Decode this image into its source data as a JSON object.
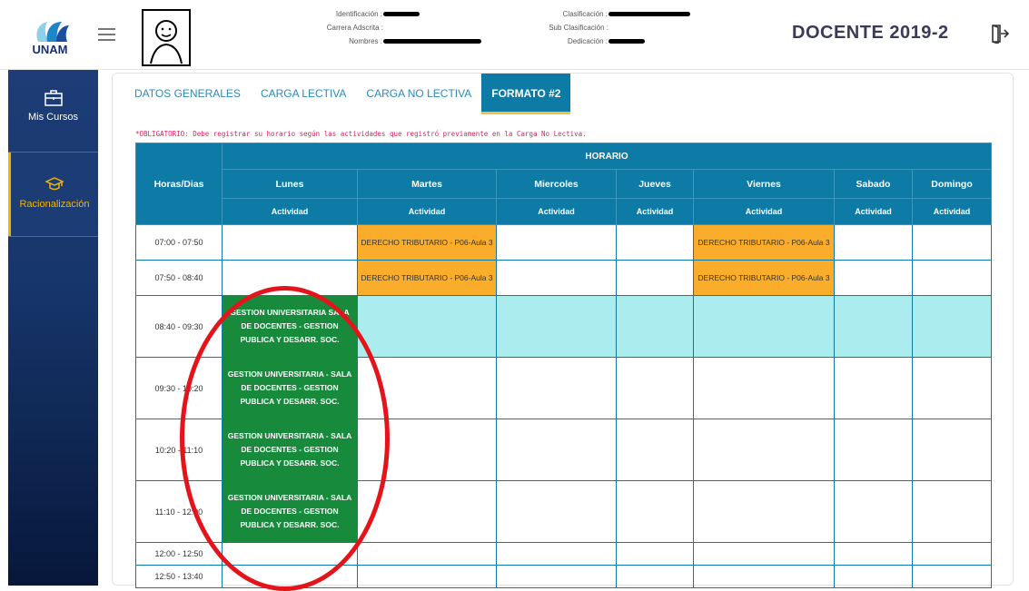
{
  "header": {
    "logo_text": "UNAM",
    "info_left": [
      {
        "label": "Identificación :",
        "redact": 40
      },
      {
        "label": "Carrera Adscrita :",
        "redact": 0
      },
      {
        "label": "Nombres :",
        "redact": 108
      }
    ],
    "info_right": [
      {
        "label": "Clasificación :",
        "redact": 90
      },
      {
        "label": "Sub Clasificación :",
        "redact": 0
      },
      {
        "label": "Dedicación :",
        "redact": 40
      }
    ],
    "page_title": "DOCENTE 2019-2"
  },
  "sidebar": {
    "items": [
      {
        "label": "Mis Cursos",
        "icon": "briefcase-icon"
      },
      {
        "label": "Racionalización",
        "icon": "graduation-cap-icon"
      }
    ]
  },
  "tabs": [
    "DATOS GENERALES",
    "CARGA LECTIVA",
    "CARGA NO LECTIVA",
    "FORMATO #2"
  ],
  "active_tab": "FORMATO #2",
  "notice": "*OBLIGATORIO: Debe registrar su horario según las actividades que registró previamente en la Carga No Lectiva.",
  "schedule": {
    "title": "HORARIO",
    "corner": "Horas/Dias",
    "days": [
      "Lunes",
      "Martes",
      "Miercoles",
      "Jueves",
      "Viernes",
      "Sabado",
      "Domingo"
    ],
    "sub_label": "Actividad",
    "rows": [
      {
        "time": "07:00 - 07:50",
        "cells": [
          "",
          "DERECHO TRIBUTARIO - P06-Aula 3",
          "",
          "",
          "DERECHO TRIBUTARIO - P06-Aula 3",
          "",
          ""
        ]
      },
      {
        "time": "07:50 - 08:40",
        "cells": [
          "",
          "DERECHO TRIBUTARIO - P06-Aula 3",
          "",
          "",
          "DERECHO TRIBUTARIO - P06-Aula 3",
          "",
          ""
        ]
      },
      {
        "time": "08:40 - 09:30",
        "cells": [
          "GESTION UNIVERSITARIA SALA DE DOCENTES - GESTION PUBLICA Y DESARR. SOC.",
          "",
          "",
          "",
          "",
          "",
          ""
        ]
      },
      {
        "time": "09:30 - 10:20",
        "cells": [
          "GESTION UNIVERSITARIA - SALA DE DOCENTES - GESTION PUBLICA Y DESARR. SOC.",
          "",
          "",
          "",
          "",
          "",
          ""
        ]
      },
      {
        "time": "10:20 - 11:10",
        "cells": [
          "GESTION UNIVERSITARIA - SALA DE DOCENTES - GESTION PUBLICA Y DESARR. SOC.",
          "",
          "",
          "",
          "",
          "",
          ""
        ]
      },
      {
        "time": "11:10 - 12:00",
        "cells": [
          "GESTION UNIVERSITARIA - SALA DE DOCENTES - GESTION PUBLICA Y DESARR. SOC.",
          "",
          "",
          "",
          "",
          "",
          ""
        ]
      },
      {
        "time": "12:00 - 12:50",
        "cells": [
          "",
          "",
          "",
          "",
          "",
          "",
          ""
        ]
      },
      {
        "time": "12:50 - 13:40",
        "cells": [
          "",
          "",
          "",
          "",
          "",
          "",
          ""
        ]
      }
    ],
    "highlight_row": "08:40 - 09:30"
  },
  "colors": {
    "primary": "#0e7aa6",
    "orange_cell": "#f9ad2a",
    "green_cell": "#178a3c",
    "highlight": "#abecee",
    "annotation": "#e4141a"
  }
}
